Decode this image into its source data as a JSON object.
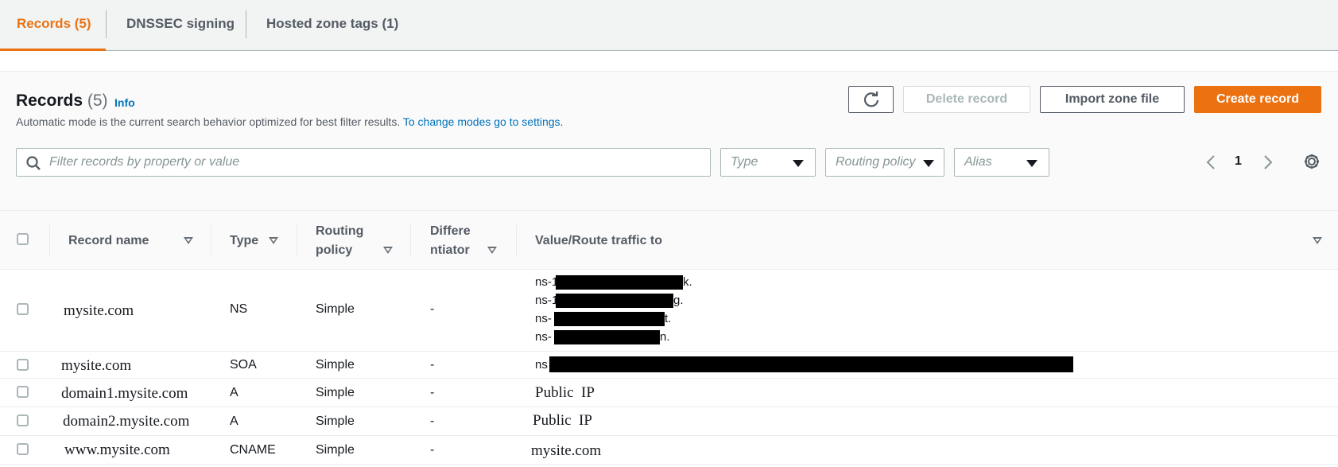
{
  "tabs": [
    {
      "label": "Records (5)"
    },
    {
      "label": "DNSSEC signing"
    },
    {
      "label": "Hosted zone tags (1)"
    }
  ],
  "records_panel": {
    "title": "Records",
    "count": "(5)",
    "info": "Info",
    "description": "Automatic mode is the current search behavior optimized for best filter results.",
    "description_link": "To change modes go to settings.",
    "buttons": {
      "delete": "Delete record",
      "import": "Import zone file",
      "create": "Create record"
    },
    "search_placeholder": "Filter records by property or value",
    "filters": {
      "type": "Type",
      "routing": "Routing policy",
      "alias": "Alias"
    },
    "page": "1"
  },
  "table": {
    "headers": {
      "record_name": "Record name",
      "type": "Type",
      "routing_1": "Routing",
      "routing_2": "policy",
      "diff_1": "Differe",
      "diff_2": "ntiator",
      "value": "Value/Route traffic to"
    },
    "rows": [
      {
        "name": "mysite.com",
        "type": "NS",
        "routing": "Simple",
        "diff": "-",
        "values": [
          "ns-1",
          "k.",
          "ns-1",
          "g.",
          "ns-",
          "t.",
          "ns-",
          "n."
        ]
      },
      {
        "name": "mysite.com",
        "type": "SOA",
        "routing": "Simple",
        "diff": "-",
        "value": "ns"
      },
      {
        "name": "domain1.mysite.com",
        "type": "A",
        "routing": "Simple",
        "diff": "-",
        "value": "Public  IP"
      },
      {
        "name": "domain2.mysite.com",
        "type": "A",
        "routing": "Simple",
        "diff": "-",
        "value": "Public  IP"
      },
      {
        "name": "www.mysite.com",
        "type": "CNAME",
        "routing": "Simple",
        "diff": "-",
        "value": "mysite.com"
      }
    ]
  },
  "colors": {
    "accent": "#ec7211",
    "link": "#0073bb"
  }
}
